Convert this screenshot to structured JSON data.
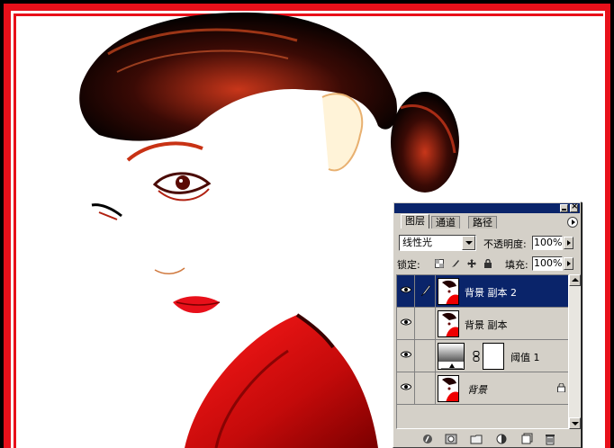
{
  "palette": {
    "tabs": [
      {
        "label": "图层",
        "active": true
      },
      {
        "label": "通道",
        "active": false
      },
      {
        "label": "路径",
        "active": false
      }
    ],
    "blend_mode": "线性光",
    "opacity_label": "不透明度:",
    "opacity_value": "100%",
    "lock_label": "锁定:",
    "fill_label": "填充:",
    "fill_value": "100%",
    "layers": [
      {
        "name": "背景 副本 2",
        "selected": true,
        "visible": true,
        "brush_icon": true
      },
      {
        "name": "背景 副本",
        "selected": false,
        "visible": true
      },
      {
        "name": "阈值 1",
        "selected": false,
        "visible": true,
        "adjustment": true
      },
      {
        "name": "背景",
        "selected": false,
        "visible": true,
        "italic": true,
        "locked": true
      }
    ],
    "bottom_buttons": [
      "layer-style-icon",
      "mask-icon",
      "new-set-icon",
      "adjustment-layer-icon",
      "new-layer-icon",
      "trash-icon"
    ],
    "colors": {
      "selected": "#0a246a",
      "panel": "#d4d0c8",
      "accent_red": "#e8101a"
    }
  }
}
